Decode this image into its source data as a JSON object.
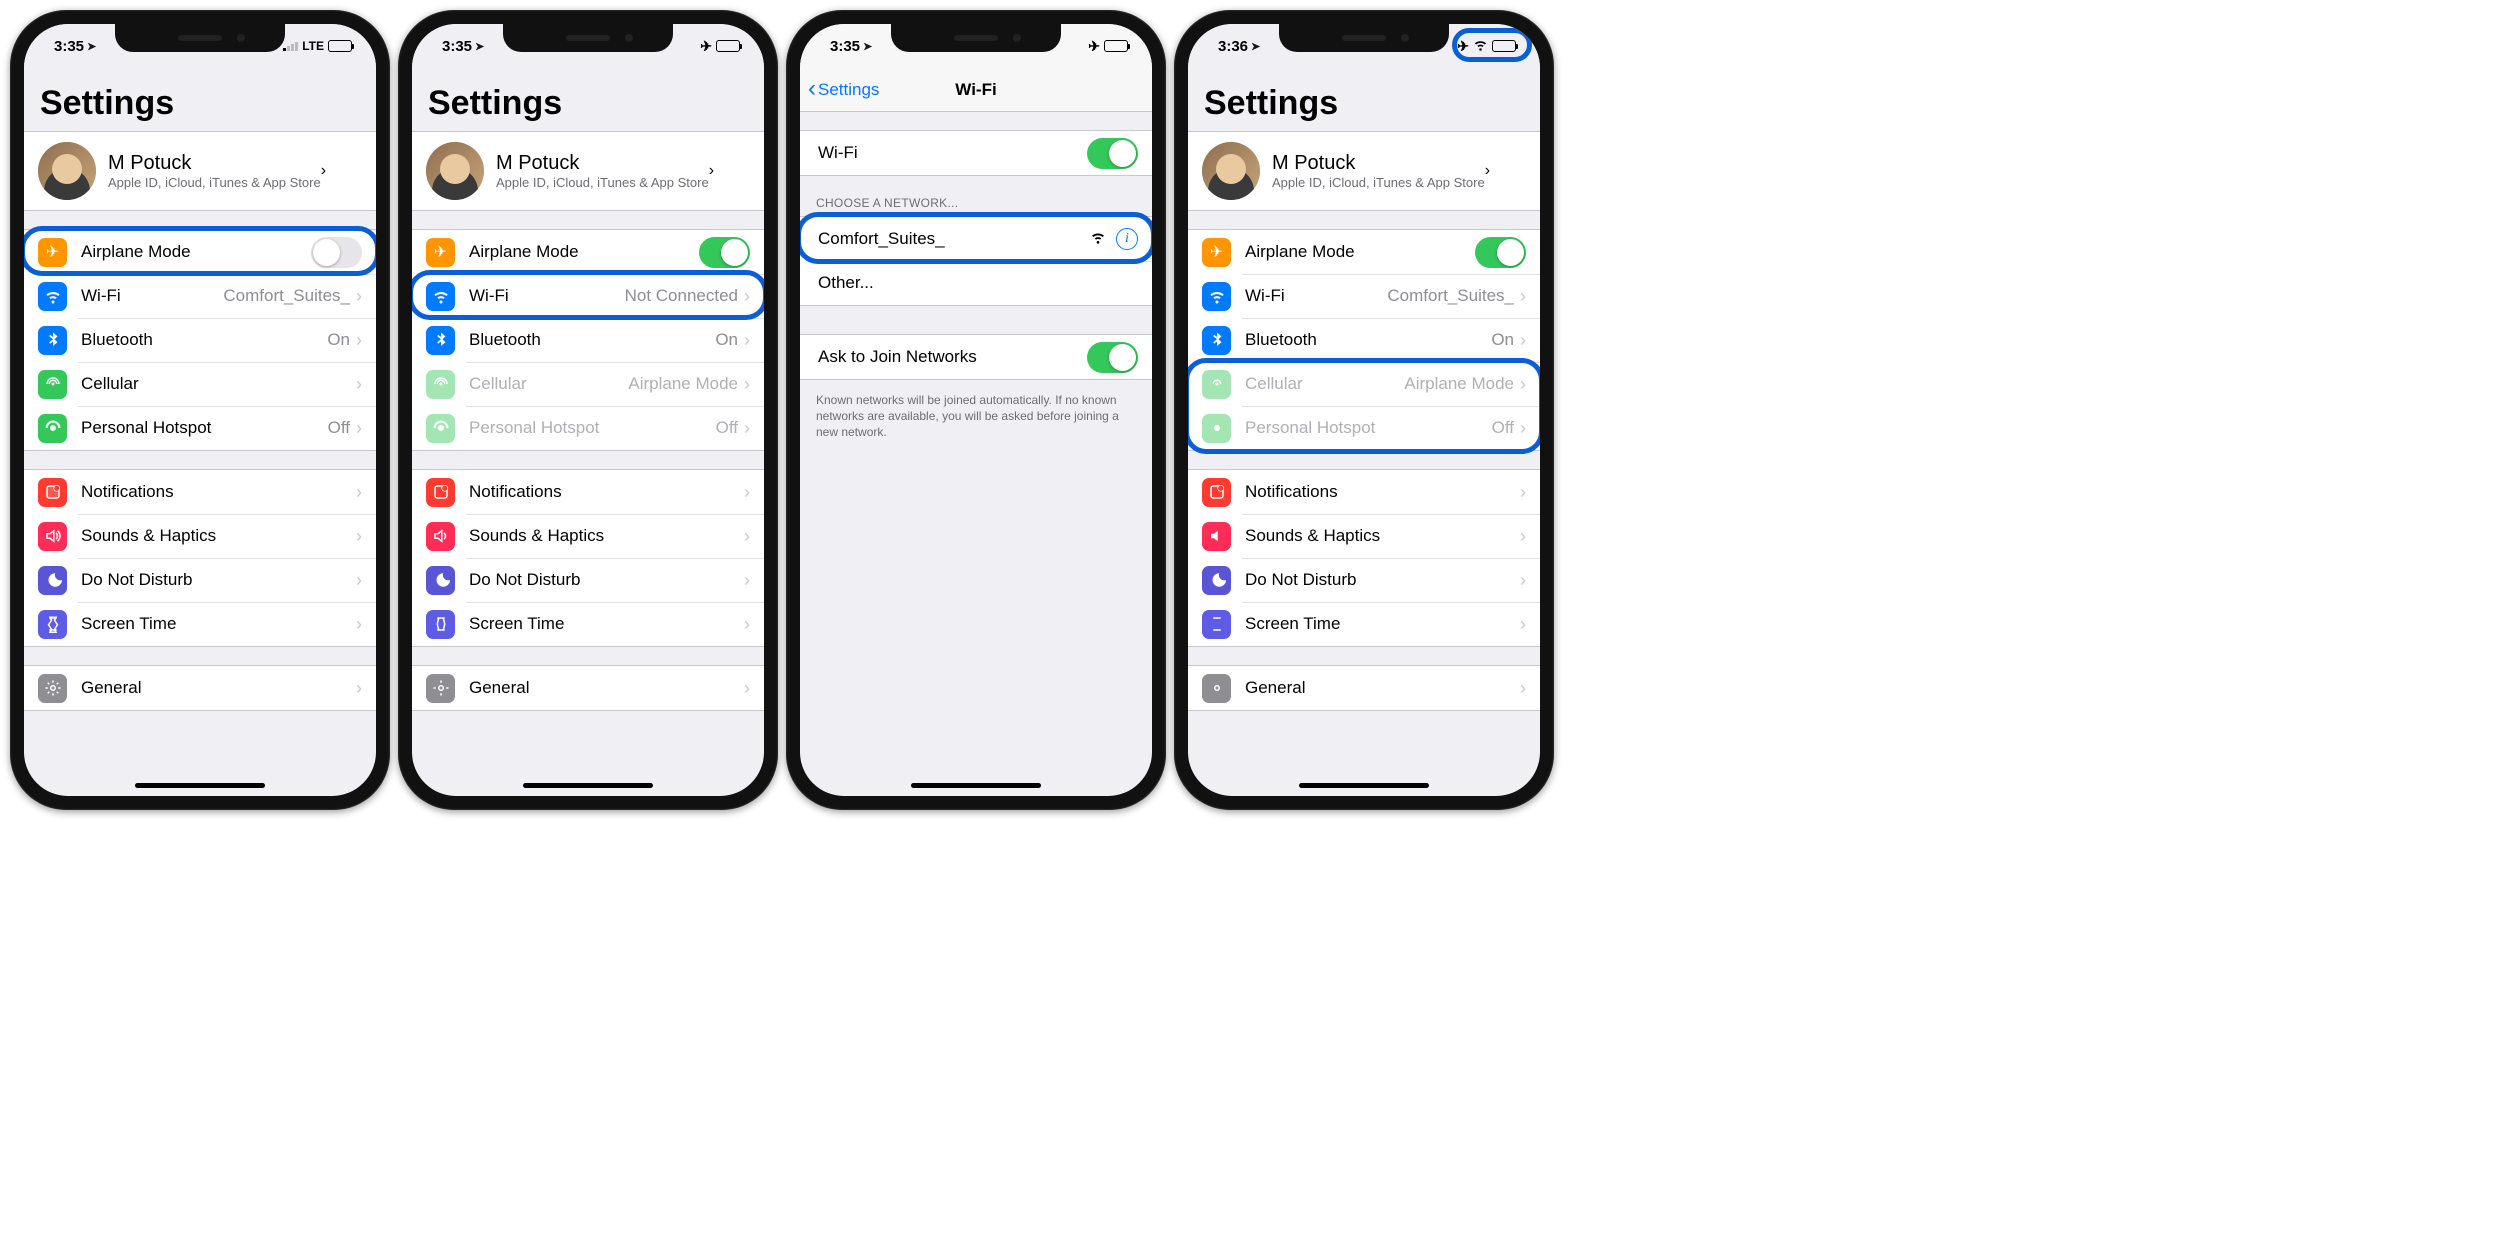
{
  "status": {
    "time_a": "3:35",
    "time_d": "3:36",
    "lte": "LTE"
  },
  "settings_title": "Settings",
  "profile": {
    "name": "M Potuck",
    "sub": "Apple ID, iCloud, iTunes & App Store"
  },
  "rows": {
    "airplane": "Airplane Mode",
    "wifi": "Wi-Fi",
    "wifi_val_a": "Comfort_Suites_",
    "wifi_val_b": "Not Connected",
    "bluetooth": "Bluetooth",
    "bt_val": "On",
    "cellular": "Cellular",
    "cell_val_air": "Airplane Mode",
    "hotspot": "Personal Hotspot",
    "hotspot_val": "Off",
    "notifications": "Notifications",
    "sounds": "Sounds & Haptics",
    "dnd": "Do Not Disturb",
    "screentime": "Screen Time",
    "general": "General"
  },
  "wifi_screen": {
    "back": "Settings",
    "title": "Wi-Fi",
    "wifi_label": "Wi-Fi",
    "choose": "CHOOSE A NETWORK...",
    "network": "Comfort_Suites_",
    "other": "Other...",
    "ask": "Ask to Join Networks",
    "footer": "Known networks will be joined automatically. If no known networks are available, you will be asked before joining a new network."
  }
}
